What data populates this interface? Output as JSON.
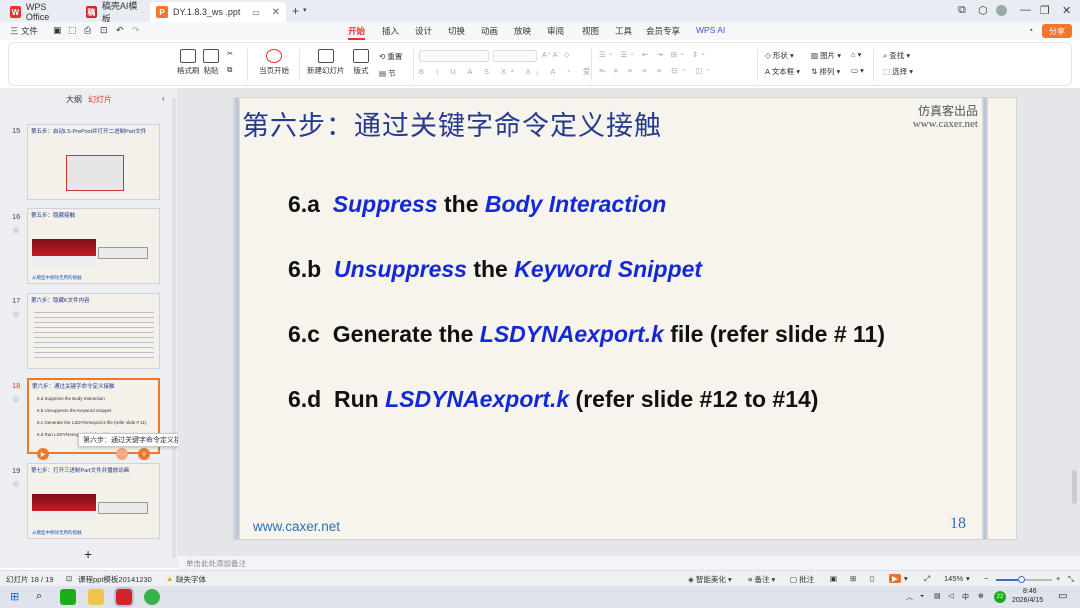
{
  "titlebar": {
    "tabs": [
      {
        "label": "WPS Office"
      },
      {
        "label": "稿壳AI模板"
      },
      {
        "label": "DY.1.8.3_ws .ppt"
      }
    ],
    "add": "+"
  },
  "menu": {
    "file": "三 文件",
    "items": [
      "开始",
      "插入",
      "设计",
      "切换",
      "动画",
      "放映",
      "审阅",
      "视图",
      "工具",
      "会员专享",
      "WPS AI"
    ],
    "share": "分享"
  },
  "ribbon": {
    "format_painter": "格式刷",
    "paste": "粘贴",
    "play_from_current": "当页开始",
    "new_slide": "新建幻灯片",
    "layout": "版式",
    "section": "节",
    "reset": "重置",
    "shape": "形状",
    "picture": "图片",
    "textbox": "文本框",
    "arrange": "排列",
    "find": "查找",
    "select": "选择"
  },
  "left_panel": {
    "tab_outline": "大纲",
    "tab_slides": "幻灯片",
    "add_symbol": "+",
    "thumbs": [
      {
        "num": "15",
        "title": "第五步：启动LS-PrePost并打开二进制Part文件"
      },
      {
        "num": "16",
        "title": "第五步：隐藏接触",
        "footer": "从模型中移除无用的接触"
      },
      {
        "num": "17",
        "title": "第六步：隐藏K文件内容"
      },
      {
        "num": "18",
        "title": "第六步：通过关键字命令定义接触",
        "lines": [
          "6.a  Suppress the Body Interaction",
          "6.b  Unsuppress the Keyword Snippet",
          "6.c  Generate the LSDYNAexport.k file (refer slide # 11)",
          "6.d  Run LSDYNAexport.k (refer slide #12 to #14)"
        ]
      },
      {
        "num": "19",
        "title": "第七步：打开三进制Part文件并播放动画",
        "footer": "从模型中移除无用的接触"
      }
    ],
    "tooltip": "第六步：通过关键字命令定义接触"
  },
  "slide": {
    "title": "第六步：通过关键字命令定义接触",
    "top_right_1": "仿真客出品",
    "top_right_2": "www.caxer.net",
    "bullets": [
      {
        "num": "6.a",
        "p1": "Suppress",
        "mid": " the ",
        "p2": "Body Interaction",
        "tail": ""
      },
      {
        "num": "6.b",
        "p1": "Unsuppress",
        "mid": " the ",
        "p2": "Keyword Snippet",
        "tail": ""
      },
      {
        "num": "6.c",
        "p1": "Generate the ",
        "mid": "",
        "p2": "LSDYNAexport.k",
        "tail": " file (refer slide # 11)"
      },
      {
        "num": "6.d",
        "p1": "Run ",
        "mid": "",
        "p2": "LSDYNAexport.k",
        "tail": " (refer slide #12 to #14)"
      }
    ],
    "footer_url": "www.caxer.net",
    "page_number": "18"
  },
  "notes_placeholder": "单击此处添加备注",
  "status": {
    "slide_counter": "幻灯片 18 / 19",
    "template": "课程ppt模板20141230",
    "missing_font": "缺失字体",
    "smart_beautify": "智能美化",
    "notes": "备注",
    "comments": "批注",
    "zoom": "145%"
  },
  "taskbar": {
    "time": "8:46",
    "date": "2026/4/15",
    "ime": "中",
    "badge": "22"
  },
  "colors": {
    "accent": "#e8332b",
    "slide_title": "#263b8f",
    "slide_blue": "#1429d6",
    "footer_blue": "#2a6fba",
    "share": "#f4762b"
  }
}
